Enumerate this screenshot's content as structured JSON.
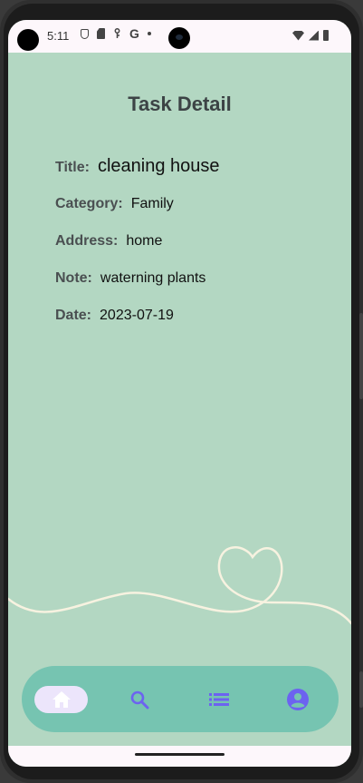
{
  "status_bar": {
    "time": "5:11",
    "left_icons": [
      "shield-icon",
      "sim-card-icon",
      "vpn-key-icon",
      "google-g-icon",
      "dot-icon"
    ],
    "right_icons": [
      "wifi-icon",
      "signal-icon",
      "battery-icon"
    ],
    "google_letter": "G"
  },
  "page": {
    "title": "Task Detail"
  },
  "task": {
    "title_label": "Title:",
    "title_value": "cleaning house",
    "category_label": "Category:",
    "category_value": "Family",
    "address_label": "Address:",
    "address_value": "home",
    "note_label": "Note:",
    "note_value": "waterning plants",
    "date_label": "Date:",
    "date_value": "2023-07-19"
  },
  "bottom_nav": {
    "items": [
      {
        "icon": "home-icon",
        "selected": true
      },
      {
        "icon": "search-icon",
        "selected": false
      },
      {
        "icon": "list-icon",
        "selected": false
      },
      {
        "icon": "account-circle-icon",
        "selected": false
      }
    ]
  },
  "colors": {
    "background": "#b3d7c2",
    "nav_background": "#76c4b1",
    "nav_icon": "#6c63f0",
    "nav_selected_pill": "#ece5fb",
    "decor_line": "#f7f2e0",
    "title_text": "#3c4345"
  }
}
